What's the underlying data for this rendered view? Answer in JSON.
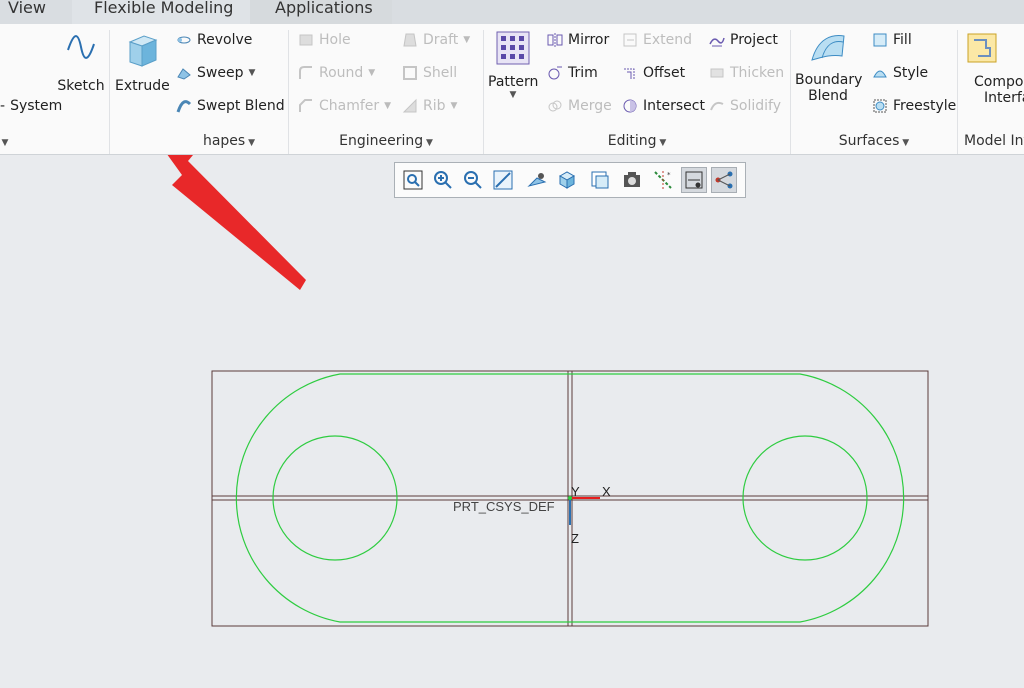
{
  "tabs": [
    "View",
    "Flexible Modeling",
    "Applications"
  ],
  "ribbon": {
    "datum": {
      "system_label": "System"
    },
    "sketch": "Sketch",
    "extrude": "Extrude",
    "shapes": {
      "revolve": "Revolve",
      "sweep": "Sweep",
      "swept_blend": "Swept Blend",
      "group_label": "hapes"
    },
    "engineering": {
      "hole": "Hole",
      "round": "Round",
      "chamfer": "Chamfer",
      "draft": "Draft",
      "shell": "Shell",
      "rib": "Rib",
      "group_label": "Engineering"
    },
    "editing": {
      "pattern": "Pattern",
      "mirror": "Mirror",
      "trim": "Trim",
      "merge": "Merge",
      "extend": "Extend",
      "offset": "Offset",
      "intersect": "Intersect",
      "project": "Project",
      "thicken": "Thicken",
      "solidify": "Solidify",
      "group_label": "Editing"
    },
    "surfaces": {
      "boundary_blend_1": "Boundary",
      "boundary_blend_2": "Blend",
      "fill": "Fill",
      "style": "Style",
      "freestyle": "Freestyle",
      "group_label": "Surfaces"
    },
    "model_intent": {
      "component_1": "Compon",
      "component_2": "Interfa",
      "group_label": "Model Int"
    }
  },
  "viewport": {
    "csys_label": "PRT_CSYS_DEF",
    "axis_y": "Y",
    "axis_x": "X",
    "axis_z": "Z"
  },
  "colors": {
    "sketch_green": "#2ecc40",
    "accent_red": "#e81d1d",
    "ribbon_bg": "#fafafa",
    "canvas_bg": "#e9ebee"
  }
}
